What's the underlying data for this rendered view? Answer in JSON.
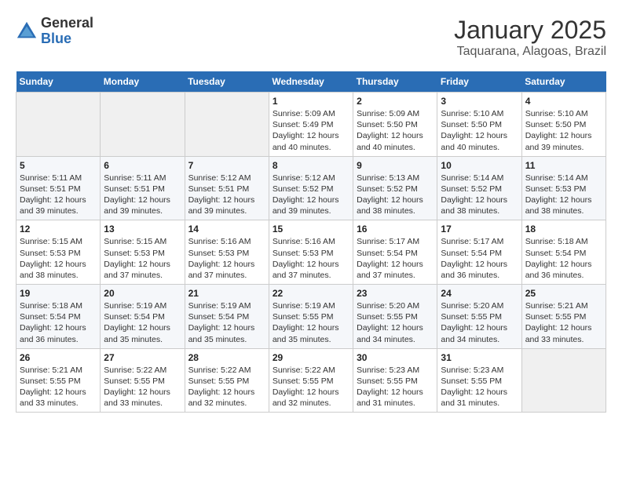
{
  "header": {
    "logo_line1": "General",
    "logo_line2": "Blue",
    "month": "January 2025",
    "location": "Taquarana, Alagoas, Brazil"
  },
  "days_of_week": [
    "Sunday",
    "Monday",
    "Tuesday",
    "Wednesday",
    "Thursday",
    "Friday",
    "Saturday"
  ],
  "weeks": [
    [
      {
        "day": "",
        "info": ""
      },
      {
        "day": "",
        "info": ""
      },
      {
        "day": "",
        "info": ""
      },
      {
        "day": "1",
        "info": "Sunrise: 5:09 AM\nSunset: 5:49 PM\nDaylight: 12 hours and 40 minutes."
      },
      {
        "day": "2",
        "info": "Sunrise: 5:09 AM\nSunset: 5:50 PM\nDaylight: 12 hours and 40 minutes."
      },
      {
        "day": "3",
        "info": "Sunrise: 5:10 AM\nSunset: 5:50 PM\nDaylight: 12 hours and 40 minutes."
      },
      {
        "day": "4",
        "info": "Sunrise: 5:10 AM\nSunset: 5:50 PM\nDaylight: 12 hours and 39 minutes."
      }
    ],
    [
      {
        "day": "5",
        "info": "Sunrise: 5:11 AM\nSunset: 5:51 PM\nDaylight: 12 hours and 39 minutes."
      },
      {
        "day": "6",
        "info": "Sunrise: 5:11 AM\nSunset: 5:51 PM\nDaylight: 12 hours and 39 minutes."
      },
      {
        "day": "7",
        "info": "Sunrise: 5:12 AM\nSunset: 5:51 PM\nDaylight: 12 hours and 39 minutes."
      },
      {
        "day": "8",
        "info": "Sunrise: 5:12 AM\nSunset: 5:52 PM\nDaylight: 12 hours and 39 minutes."
      },
      {
        "day": "9",
        "info": "Sunrise: 5:13 AM\nSunset: 5:52 PM\nDaylight: 12 hours and 38 minutes."
      },
      {
        "day": "10",
        "info": "Sunrise: 5:14 AM\nSunset: 5:52 PM\nDaylight: 12 hours and 38 minutes."
      },
      {
        "day": "11",
        "info": "Sunrise: 5:14 AM\nSunset: 5:53 PM\nDaylight: 12 hours and 38 minutes."
      }
    ],
    [
      {
        "day": "12",
        "info": "Sunrise: 5:15 AM\nSunset: 5:53 PM\nDaylight: 12 hours and 38 minutes."
      },
      {
        "day": "13",
        "info": "Sunrise: 5:15 AM\nSunset: 5:53 PM\nDaylight: 12 hours and 37 minutes."
      },
      {
        "day": "14",
        "info": "Sunrise: 5:16 AM\nSunset: 5:53 PM\nDaylight: 12 hours and 37 minutes."
      },
      {
        "day": "15",
        "info": "Sunrise: 5:16 AM\nSunset: 5:53 PM\nDaylight: 12 hours and 37 minutes."
      },
      {
        "day": "16",
        "info": "Sunrise: 5:17 AM\nSunset: 5:54 PM\nDaylight: 12 hours and 37 minutes."
      },
      {
        "day": "17",
        "info": "Sunrise: 5:17 AM\nSunset: 5:54 PM\nDaylight: 12 hours and 36 minutes."
      },
      {
        "day": "18",
        "info": "Sunrise: 5:18 AM\nSunset: 5:54 PM\nDaylight: 12 hours and 36 minutes."
      }
    ],
    [
      {
        "day": "19",
        "info": "Sunrise: 5:18 AM\nSunset: 5:54 PM\nDaylight: 12 hours and 36 minutes."
      },
      {
        "day": "20",
        "info": "Sunrise: 5:19 AM\nSunset: 5:54 PM\nDaylight: 12 hours and 35 minutes."
      },
      {
        "day": "21",
        "info": "Sunrise: 5:19 AM\nSunset: 5:54 PM\nDaylight: 12 hours and 35 minutes."
      },
      {
        "day": "22",
        "info": "Sunrise: 5:19 AM\nSunset: 5:55 PM\nDaylight: 12 hours and 35 minutes."
      },
      {
        "day": "23",
        "info": "Sunrise: 5:20 AM\nSunset: 5:55 PM\nDaylight: 12 hours and 34 minutes."
      },
      {
        "day": "24",
        "info": "Sunrise: 5:20 AM\nSunset: 5:55 PM\nDaylight: 12 hours and 34 minutes."
      },
      {
        "day": "25",
        "info": "Sunrise: 5:21 AM\nSunset: 5:55 PM\nDaylight: 12 hours and 33 minutes."
      }
    ],
    [
      {
        "day": "26",
        "info": "Sunrise: 5:21 AM\nSunset: 5:55 PM\nDaylight: 12 hours and 33 minutes."
      },
      {
        "day": "27",
        "info": "Sunrise: 5:22 AM\nSunset: 5:55 PM\nDaylight: 12 hours and 33 minutes."
      },
      {
        "day": "28",
        "info": "Sunrise: 5:22 AM\nSunset: 5:55 PM\nDaylight: 12 hours and 32 minutes."
      },
      {
        "day": "29",
        "info": "Sunrise: 5:22 AM\nSunset: 5:55 PM\nDaylight: 12 hours and 32 minutes."
      },
      {
        "day": "30",
        "info": "Sunrise: 5:23 AM\nSunset: 5:55 PM\nDaylight: 12 hours and 31 minutes."
      },
      {
        "day": "31",
        "info": "Sunrise: 5:23 AM\nSunset: 5:55 PM\nDaylight: 12 hours and 31 minutes."
      },
      {
        "day": "",
        "info": ""
      }
    ]
  ]
}
